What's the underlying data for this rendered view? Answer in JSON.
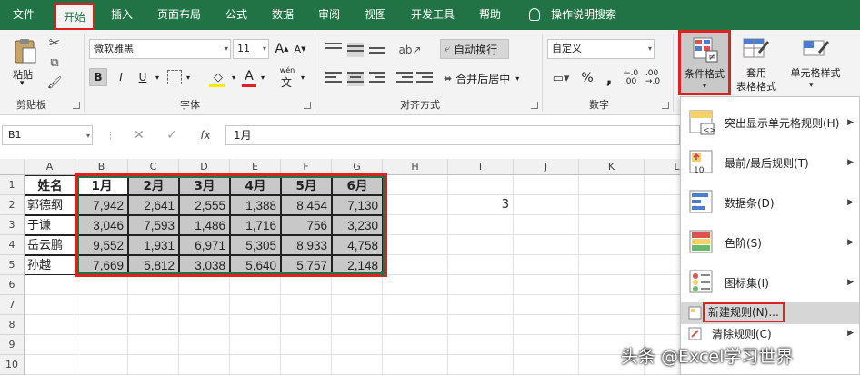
{
  "menu": {
    "items": [
      "文件",
      "开始",
      "插入",
      "页面布局",
      "公式",
      "数据",
      "审阅",
      "视图",
      "开发工具",
      "帮助"
    ],
    "tell_me": "操作说明搜索"
  },
  "ribbon": {
    "clipboard": {
      "paste": "粘贴",
      "label": "剪贴板"
    },
    "font": {
      "name": "微软雅黑",
      "size": "11",
      "bold": "B",
      "italic": "I",
      "underline": "U",
      "grow": "A",
      "shrink": "A",
      "color_a": "A",
      "wen": "wén",
      "wen2": "文",
      "label": "字体"
    },
    "alignment": {
      "wrap": "自动换行",
      "merge": "合并后居中",
      "label": "对齐方式"
    },
    "number": {
      "format": "自定义",
      "percent": "%",
      "comma": ",",
      "label": "数字"
    },
    "styles": {
      "cond": "条件格式",
      "table1": "套用",
      "table2": "表格格式",
      "cell": "单元格样式"
    }
  },
  "formula_bar": {
    "name_box": "B1",
    "fx": "fx",
    "content": "1月"
  },
  "columns": [
    "A",
    "B",
    "C",
    "D",
    "E",
    "F",
    "G",
    "H",
    "I",
    "J",
    "K",
    "L"
  ],
  "rows": [
    "1",
    "2",
    "3",
    "4",
    "5",
    "6",
    "7",
    "8",
    "9",
    "10"
  ],
  "table": {
    "header": [
      "姓名",
      "1月",
      "2月",
      "3月",
      "4月",
      "5月",
      "6月"
    ],
    "rows": [
      [
        "郭德纲",
        "7,942",
        "2,641",
        "2,555",
        "1,388",
        "8,454",
        "7,130"
      ],
      [
        "于谦",
        "3,046",
        "7,593",
        "1,486",
        "1,716",
        "756",
        "3,230"
      ],
      [
        "岳云鹏",
        "9,552",
        "1,931",
        "6,971",
        "5,305",
        "8,933",
        "4,758"
      ],
      [
        "孙越",
        "7,669",
        "5,812",
        "3,038",
        "5,640",
        "5,757",
        "2,148"
      ]
    ]
  },
  "cell_i2": "3",
  "dropdown": {
    "items": [
      {
        "label": "突出显示单元格规则(H)",
        "arrow": "▶"
      },
      {
        "label": "最前/最后规则(T)",
        "arrow": "▶"
      },
      {
        "label": "数据条(D)",
        "arrow": "▶"
      },
      {
        "label": "色阶(S)",
        "arrow": "▶"
      },
      {
        "label": "图标集(I)",
        "arrow": "▶"
      }
    ],
    "new_rule": "新建规则(N)...",
    "clear_rule": "清除规则(C)",
    "clear_arrow": "▶",
    "icon_num": "10"
  },
  "watermark": "头条 @Excel学习世界",
  "colors": {
    "excel_green": "#217346",
    "highlight_red": "#d22222"
  }
}
